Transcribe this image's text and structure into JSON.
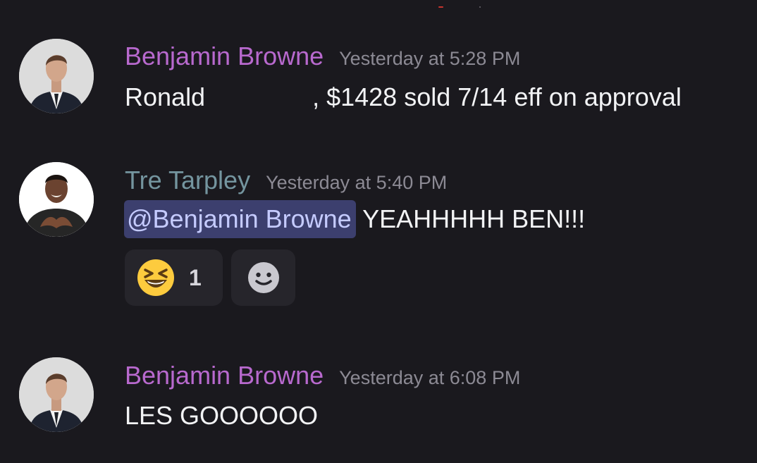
{
  "messages": [
    {
      "author": "Benjamin Browne",
      "timestamp": "Yesterday at 5:28 PM",
      "text_before": "Ronald",
      "text_after": ", $1428 sold 7/14 eff on approval"
    },
    {
      "author": "Tre Tarpley",
      "timestamp": "Yesterday at 5:40 PM",
      "mention": "@Benjamin Browne",
      "text": "YEAHHHHH BEN!!!",
      "reactions": [
        {
          "emoji": "grinning-squinting-face",
          "count": "1"
        }
      ],
      "add_reaction_icon": "add-reaction-smiley"
    },
    {
      "author": "Benjamin Browne",
      "timestamp": "Yesterday at 6:08 PM",
      "text": "LES GOOOOOO"
    }
  ],
  "colors": {
    "background": "#1a191e",
    "username_benjamin": "#b869ce",
    "username_tre": "#74959f",
    "timestamp": "#8c8a94",
    "mention_bg": "#3c3f6e",
    "mention_text": "#c5cbff",
    "reaction_bg": "#26252b"
  }
}
